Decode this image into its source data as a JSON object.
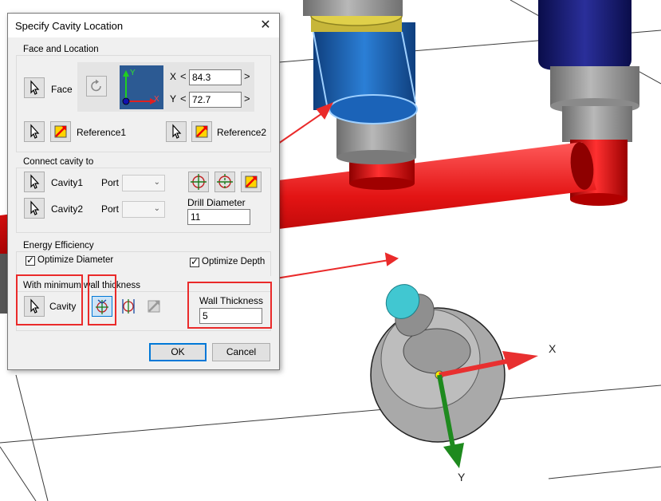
{
  "dialog": {
    "title": "Specify Cavity Location",
    "close_glyph": "✕",
    "face_location": {
      "group_label": "Face and Location",
      "face_label": "Face",
      "x_label": "X",
      "x_value": "84.3",
      "y_label": "Y",
      "y_value": "72.7",
      "axis_y": "Y",
      "axis_x": "X",
      "reference1_label": "Reference1",
      "reference2_label": "Reference2",
      "arrow_left": "<",
      "arrow_right": ">"
    },
    "connect": {
      "group_label": "Connect cavity to",
      "cavity1_label": "Cavity1",
      "cavity2_label": "Cavity2",
      "port_label": "Port",
      "drill_diameter_label": "Drill Diameter",
      "drill_diameter_value": "11"
    },
    "energy": {
      "group_label": "Energy Efficiency",
      "optimize_diameter_label": "Optimize Diameter",
      "optimize_diameter_checked": true,
      "optimize_depth_label": "Optimize Depth",
      "optimize_depth_checked": true
    },
    "wall": {
      "group_label": "With minimum wall thickness",
      "cavity_label": "Cavity",
      "wall_thickness_label": "Wall Thickness",
      "wall_thickness_value": "5"
    },
    "ok_label": "OK",
    "cancel_label": "Cancel"
  },
  "viewport": {
    "axis_x_label": "X",
    "axis_y_label": "Y"
  },
  "icons": [
    "cursor-icon",
    "rotate-icon",
    "reference-arrow-icon",
    "crosshair-icon",
    "crosshair-split-icon",
    "center-marker-icon",
    "checkmark-icon",
    "close-icon"
  ],
  "colors": {
    "highlight_red": "#ea2a2a",
    "pipe_red": "#e31414",
    "navy": "#1a1d7c",
    "blue_cylinder": "#1b63b8",
    "accent_blue": "#0078d7",
    "axis_x_red": "#e83030",
    "axis_y_green": "#1e8a1e"
  }
}
